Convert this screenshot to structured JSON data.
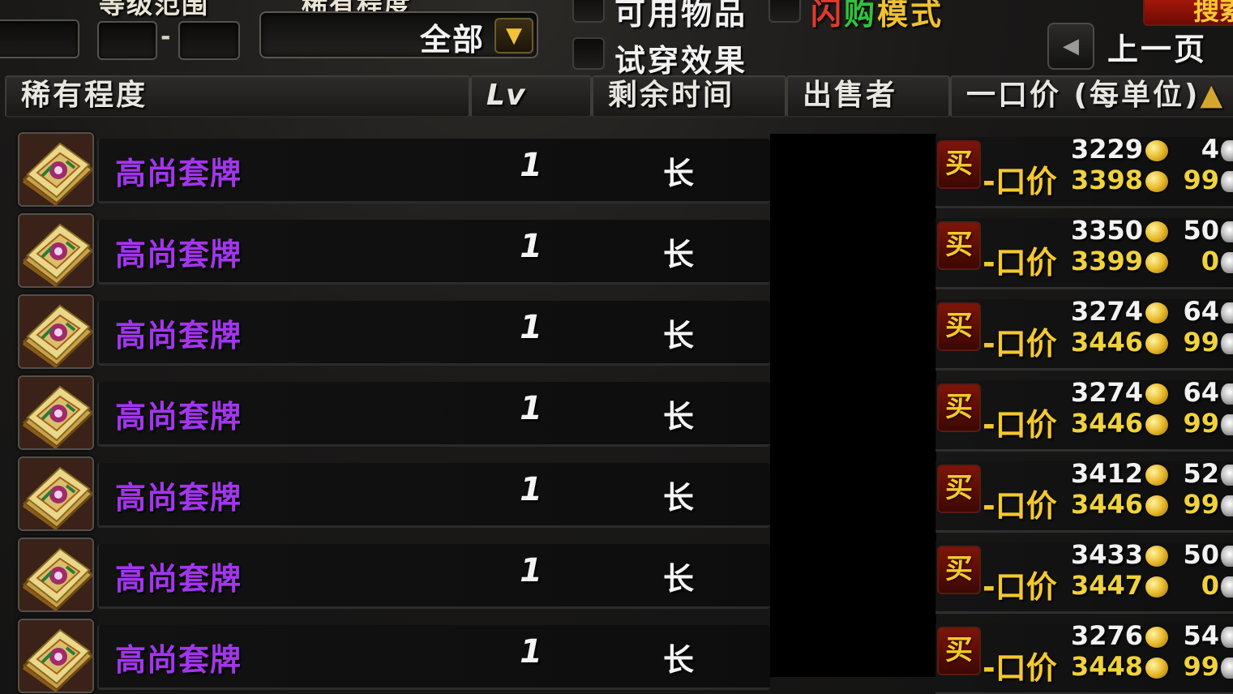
{
  "filters": {
    "level_range_label": "等级范围",
    "level_separator": "-",
    "rarity_label": "稀有程度",
    "rarity_selected": "全部",
    "usable_items_label": "可用物品",
    "preview_label": "试穿效果",
    "flash_buy_label": "闪购模式",
    "search_label": "搜索",
    "prev_page_label": "上一页"
  },
  "colors": {
    "epic_item": "#a335ee",
    "gold_text": "#f6c82c",
    "flash_mode": [
      "#e23a2a",
      "#2fc43a",
      "#efc12e"
    ]
  },
  "columns": {
    "rarity": "稀有程度",
    "level": "Lv",
    "time_left": "剩余时间",
    "seller": "出售者",
    "buyout": "一口价 (每单位)"
  },
  "buyout_label": "-口价",
  "buy_button": "买",
  "rows": [
    {
      "name": "高尚套牌",
      "level": "1",
      "time": "长",
      "bid_gold": "3229",
      "bid_silver": "4",
      "buyout_gold": "3398",
      "buyout_silver": "99"
    },
    {
      "name": "高尚套牌",
      "level": "1",
      "time": "长",
      "bid_gold": "3350",
      "bid_silver": "50",
      "buyout_gold": "3399",
      "buyout_silver": "0"
    },
    {
      "name": "高尚套牌",
      "level": "1",
      "time": "长",
      "bid_gold": "3274",
      "bid_silver": "64",
      "buyout_gold": "3446",
      "buyout_silver": "99"
    },
    {
      "name": "高尚套牌",
      "level": "1",
      "time": "长",
      "bid_gold": "3274",
      "bid_silver": "64",
      "buyout_gold": "3446",
      "buyout_silver": "99"
    },
    {
      "name": "高尚套牌",
      "level": "1",
      "time": "长",
      "bid_gold": "3412",
      "bid_silver": "52",
      "buyout_gold": "3446",
      "buyout_silver": "99"
    },
    {
      "name": "高尚套牌",
      "level": "1",
      "time": "长",
      "bid_gold": "3433",
      "bid_silver": "50",
      "buyout_gold": "3447",
      "buyout_silver": "0"
    },
    {
      "name": "高尚套牌",
      "level": "1",
      "time": "长",
      "bid_gold": "3276",
      "bid_silver": "54",
      "buyout_gold": "3448",
      "buyout_silver": "99"
    }
  ]
}
